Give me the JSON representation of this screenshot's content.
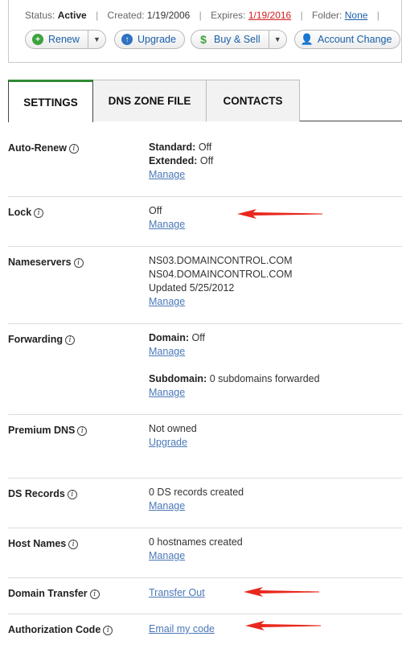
{
  "status": {
    "status_label": "Status:",
    "status_value": "Active",
    "created_label": "Created:",
    "created_value": "1/19/2006",
    "expires_label": "Expires:",
    "expires_value": "1/19/2016",
    "folder_label": "Folder:",
    "folder_value": "None"
  },
  "buttons": {
    "renew": "Renew",
    "upgrade": "Upgrade",
    "buy_sell": "Buy & Sell",
    "account_change": "Account Change"
  },
  "tabs": [
    {
      "label": "SETTINGS"
    },
    {
      "label": "DNS ZONE FILE"
    },
    {
      "label": "CONTACTS"
    }
  ],
  "settings": {
    "auto_renew": {
      "name": "Auto-Renew",
      "standard_label": "Standard:",
      "standard_value": "Off",
      "extended_label": "Extended:",
      "extended_value": "Off",
      "link": "Manage"
    },
    "lock": {
      "name": "Lock",
      "value": "Off",
      "link": "Manage"
    },
    "nameservers": {
      "name": "Nameservers",
      "ns1": "NS03.DOMAINCONTROL.COM",
      "ns2": "NS04.DOMAINCONTROL.COM",
      "updated": "Updated 5/25/2012",
      "link": "Manage"
    },
    "forwarding": {
      "name": "Forwarding",
      "domain_label": "Domain:",
      "domain_value": "Off",
      "link1": "Manage",
      "subdomain_label": "Subdomain:",
      "subdomain_value": "0 subdomains forwarded",
      "link2": "Manage"
    },
    "premium_dns": {
      "name": "Premium DNS",
      "value": "Not owned",
      "link": "Upgrade"
    },
    "ds_records": {
      "name": "DS Records",
      "value": "0 DS records created",
      "link": "Manage"
    },
    "host_names": {
      "name": "Host Names",
      "value": "0 hostnames created",
      "link": "Manage"
    },
    "domain_transfer": {
      "name": "Domain Transfer",
      "link": "Transfer Out"
    },
    "auth_code": {
      "name": "Authorization Code",
      "link": "Email my code"
    }
  },
  "colors": {
    "arrow": "#e8281e",
    "active_tab_accent": "#2f8a33",
    "link": "#4a78b8"
  },
  "icons": {
    "info": "i",
    "renew": "plus-circle-icon",
    "upgrade": "up-arrow-circle-icon",
    "buy_sell": "dollar-icon",
    "account_change": "person-icon"
  }
}
